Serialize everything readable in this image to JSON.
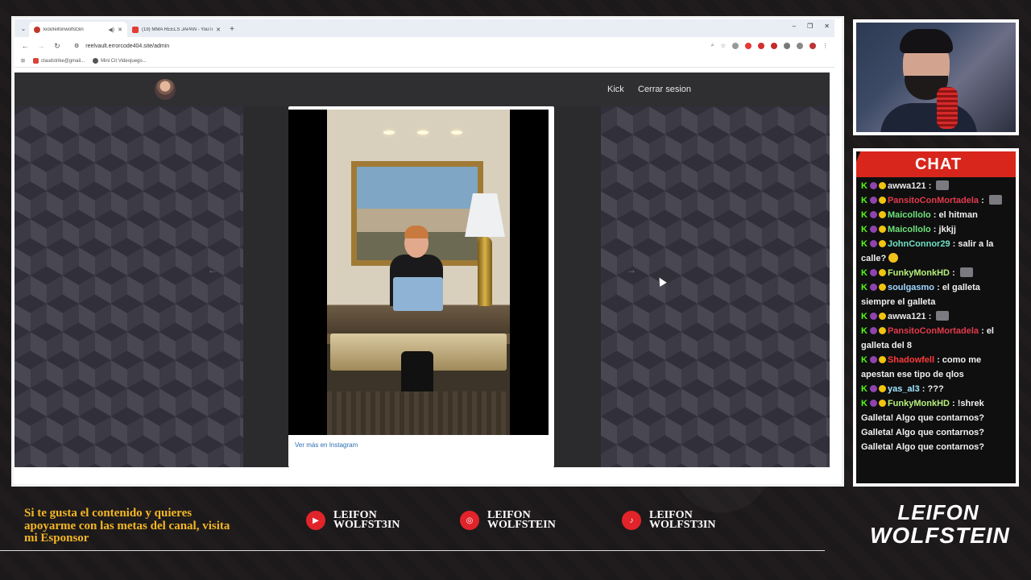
{
  "browser": {
    "tabs": [
      {
        "title": "kick/leifonwolfst3in",
        "active": true,
        "favicon_color": "#c0392b"
      },
      {
        "title": "(19) MMA REELS JAPAN - YouTu...",
        "active": false,
        "favicon_color": "#e53935"
      }
    ],
    "address": "reelvault.errorcode404.site/admin",
    "bookmarks": [
      {
        "label": "claudstrike@gmail...",
        "icon_color": "#d44638"
      },
      {
        "label": "Mini Cit Videojuego...",
        "icon_color": "#555555"
      }
    ]
  },
  "site": {
    "nav": {
      "kick_label": "Kick",
      "logout_label": "Cerrar sesion"
    },
    "embed": {
      "link_label": "Ver más en Instagram"
    }
  },
  "chat": {
    "title": "CHAT",
    "messages": [
      {
        "user": "awwa121",
        "user_color": "#e8e8e8",
        "text": "",
        "emote": true
      },
      {
        "user": "PansitoConMortadela",
        "user_color": "#e23a4a",
        "text": "",
        "emote": true
      },
      {
        "user": "Maicollolo",
        "user_color": "#6ee37a",
        "text": "el hitman"
      },
      {
        "user": "Maicollolo",
        "user_color": "#6ee37a",
        "text": "jkkjj"
      },
      {
        "user": "JohnConnor29",
        "user_color": "#6ee3c4",
        "text": "salir a la calle?",
        "emoji": true
      },
      {
        "user": "FunkyMonkHD",
        "user_color": "#b6f07a",
        "text": "",
        "emote": true
      },
      {
        "user": "soulgasmo",
        "user_color": "#9fd6ff",
        "text": "el galleta siempre el galleta"
      },
      {
        "user": "awwa121",
        "user_color": "#e8e8e8",
        "text": "",
        "emote": true
      },
      {
        "user": "PansitoConMortadela",
        "user_color": "#e23a4a",
        "text": "el galleta del 8"
      },
      {
        "user": "Shadowfell",
        "user_color": "#ff3a3a",
        "text": "como me apestan ese tipo de qlos"
      },
      {
        "user": "yas_al3",
        "user_color": "#9fe6ff",
        "text": "???"
      },
      {
        "user": "FunkyMonkHD",
        "user_color": "#b6f07a",
        "text": "!shrek"
      }
    ],
    "system_lines": [
      "Galleta! Algo que contarnos?",
      "Galleta! Algo que contarnos?",
      "Galleta! Algo que contarnos?"
    ]
  },
  "footer": {
    "support_text": "Si te gusta el contenido y quieres apoyarme con las metas del canal, visita mi Esponsor",
    "socials": [
      {
        "platform_icon": "youtube-icon",
        "glyph": "▶",
        "line1": "LEIFON",
        "line2": "WOLFST3IN"
      },
      {
        "platform_icon": "instagram-icon",
        "glyph": "◎",
        "line1": "LEIFON",
        "line2": "WOLFSTEIN"
      },
      {
        "platform_icon": "tiktok-icon",
        "glyph": "♪",
        "line1": "LEIFON",
        "line2": "WOLFST3IN"
      }
    ],
    "brand": {
      "line1": "LEIFON",
      "line2": "WOLFSTEIN"
    }
  },
  "colors": {
    "accent_red": "#d8261c",
    "gold_text": "#f5b824",
    "kick_green": "#53fc18"
  }
}
